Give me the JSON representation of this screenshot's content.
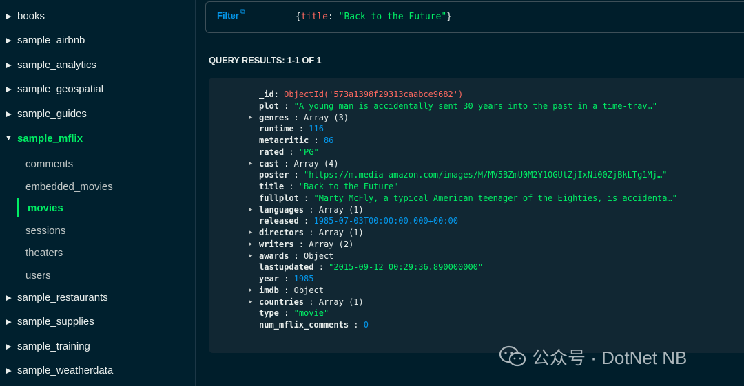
{
  "sidebar": {
    "databases_top": [
      "books",
      "sample_airbnb",
      "sample_analytics",
      "sample_geospatial",
      "sample_guides"
    ],
    "expanded_db": "sample_mflix",
    "collections": [
      "comments",
      "embedded_movies",
      "movies",
      "sessions",
      "theaters",
      "users"
    ],
    "active_collection": "movies",
    "databases_bottom": [
      "sample_restaurants",
      "sample_supplies",
      "sample_training",
      "sample_weatherdata"
    ]
  },
  "filter": {
    "label": "Filter",
    "query_open": "{",
    "query_key": "title",
    "query_sep": ": ",
    "query_value": "\"Back to the Future\"",
    "query_close": "}"
  },
  "results": {
    "heading": "QUERY RESULTS: 1-1 OF 1"
  },
  "document": {
    "fields": [
      {
        "name": "_id",
        "value": "ObjectId('573a1398f29313caabce9682')",
        "kind": "oid",
        "expandable": false
      },
      {
        "name": "plot",
        "value": "\"A young man is accidentally sent 30 years into the past in a time-trav…\"",
        "kind": "string",
        "expandable": false
      },
      {
        "name": "genres",
        "value": "Array (3)",
        "kind": "type",
        "expandable": true
      },
      {
        "name": "runtime",
        "value": "116",
        "kind": "number",
        "expandable": false
      },
      {
        "name": "metacritic",
        "value": "86",
        "kind": "number",
        "expandable": false
      },
      {
        "name": "rated",
        "value": "\"PG\"",
        "kind": "string",
        "expandable": false
      },
      {
        "name": "cast",
        "value": "Array (4)",
        "kind": "type",
        "expandable": true
      },
      {
        "name": "poster",
        "value": "\"https://m.media-amazon.com/images/M/MV5BZmU0M2Y1OGUtZjIxNi00ZjBkLTg1Mj…\"",
        "kind": "string",
        "expandable": false
      },
      {
        "name": "title",
        "value": "\"Back to the Future\"",
        "kind": "string",
        "expandable": false
      },
      {
        "name": "fullplot",
        "value": "\"Marty McFly, a typical American teenager of the Eighties, is accidenta…\"",
        "kind": "string",
        "expandable": false
      },
      {
        "name": "languages",
        "value": "Array (1)",
        "kind": "type",
        "expandable": true
      },
      {
        "name": "released",
        "value": "1985-07-03T00:00:00.000+00:00",
        "kind": "date",
        "expandable": false
      },
      {
        "name": "directors",
        "value": "Array (1)",
        "kind": "type",
        "expandable": true
      },
      {
        "name": "writers",
        "value": "Array (2)",
        "kind": "type",
        "expandable": true
      },
      {
        "name": "awards",
        "value": "Object",
        "kind": "type",
        "expandable": true
      },
      {
        "name": "lastupdated",
        "value": "\"2015-09-12 00:29:36.890000000\"",
        "kind": "string",
        "expandable": false
      },
      {
        "name": "year",
        "value": "1985",
        "kind": "number",
        "expandable": false
      },
      {
        "name": "imdb",
        "value": "Object",
        "kind": "type",
        "expandable": true
      },
      {
        "name": "countries",
        "value": "Array (1)",
        "kind": "type",
        "expandable": true
      },
      {
        "name": "type",
        "value": "\"movie\"",
        "kind": "string",
        "expandable": false
      },
      {
        "name": "num_mflix_comments",
        "value": "0",
        "kind": "number",
        "expandable": false
      }
    ]
  },
  "watermark": {
    "text": "公众号 · DotNet NB"
  },
  "colors": {
    "accent_green": "#00ed64",
    "link_blue": "#0498ec",
    "oid_red": "#ff6960",
    "background": "#001e2b"
  }
}
